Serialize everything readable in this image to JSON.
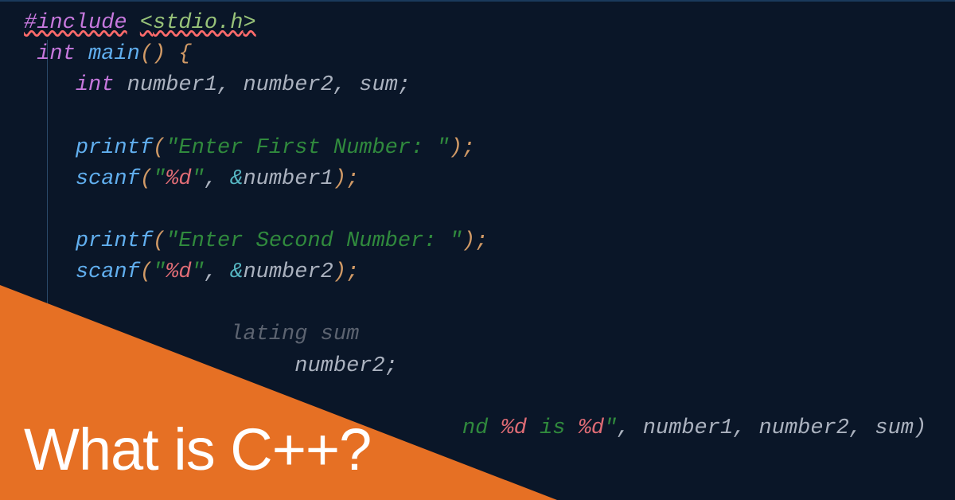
{
  "code": {
    "line1": {
      "include": "#include",
      "path_open": "<",
      "path": "stdio.h",
      "path_close": ">"
    },
    "line2": {
      "type": "int",
      "func": "main",
      "parens": "()",
      "brace": " {"
    },
    "line3": {
      "indent": "    ",
      "type": "int",
      "vars": " number1, number2, sum;"
    },
    "line5": {
      "indent": "    ",
      "func": "printf",
      "popen": "(",
      "str": "\"Enter First Number: \"",
      "pclose": ");"
    },
    "line6": {
      "indent": "    ",
      "func": "scanf",
      "popen": "(",
      "strbeg": "\"",
      "fmt": "%d",
      "strend": "\"",
      "comma": ", ",
      "amp": "&",
      "var": "number1",
      "pclose": ");"
    },
    "line8": {
      "indent": "    ",
      "func": "printf",
      "popen": "(",
      "str": "\"Enter Second Number: \"",
      "pclose": ");"
    },
    "line9": {
      "indent": "    ",
      "func": "scanf",
      "popen": "(",
      "strbeg": "\"",
      "fmt": "%d",
      "strend": "\"",
      "comma": ", ",
      "amp": "&",
      "var": "number2",
      "pclose": ");"
    },
    "line11": {
      "frag": "lating sum"
    },
    "line12": {
      "frag": " number2;"
    },
    "line14": {
      "strlead": "nd ",
      "fmt1": "%d",
      "mid": " is ",
      "fmt2": "%d",
      "strend": "\"",
      "rest": ", number1, number2, sum)"
    }
  },
  "overlay": {
    "title": "What is C++?"
  }
}
